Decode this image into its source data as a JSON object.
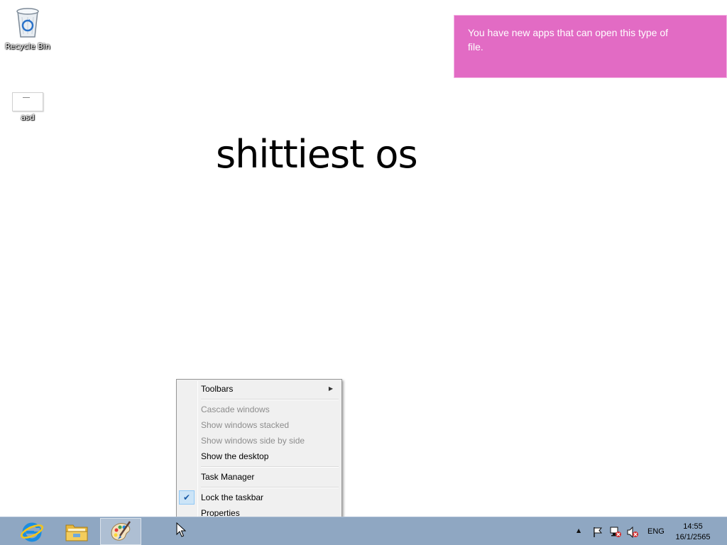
{
  "desktop": {
    "icons": [
      {
        "label": "Recycle Bin",
        "icon": "recycle-bin-icon"
      },
      {
        "label": "asd",
        "icon": "file-thumbnail-icon"
      }
    ],
    "wallpaper_text": "shittiest os"
  },
  "notification": {
    "message": "You have new apps that can open this type of file.",
    "color": "#e26bc4"
  },
  "context_menu": {
    "toolbars": "Toolbars",
    "cascade": "Cascade windows",
    "stacked": "Show windows stacked",
    "side_by_side": "Show windows side by side",
    "show_desktop": "Show the desktop",
    "task_manager": "Task Manager",
    "lock_taskbar": "Lock the taskbar",
    "properties": "Properties"
  },
  "taskbar": {
    "pinned": [
      "internet-explorer-icon",
      "file-explorer-icon",
      "paint-icon"
    ],
    "language": "ENG",
    "time": "14:55",
    "date": "16/1/2565",
    "color": "#8fa7c2"
  }
}
